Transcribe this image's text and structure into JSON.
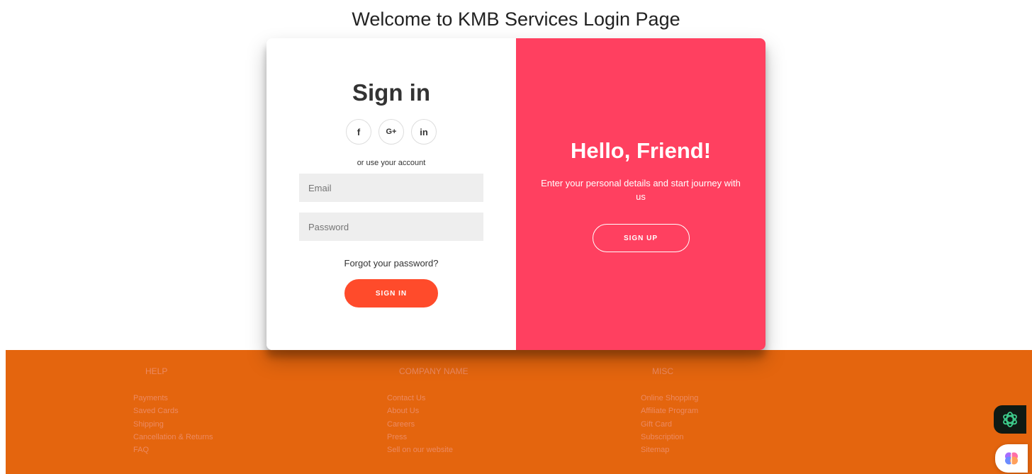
{
  "page": {
    "title": "Welcome to KMB Services Login Page"
  },
  "signin": {
    "title": "Sign in",
    "social": [
      {
        "label": "f",
        "icon": "facebook-icon"
      },
      {
        "label": "G+",
        "icon": "google-plus-icon"
      },
      {
        "label": "in",
        "icon": "linkedin-icon"
      }
    ],
    "use_account": "or use your account",
    "email_placeholder": "Email",
    "email_value": "",
    "password_placeholder": "Password",
    "password_value": "",
    "forgot": "Forgot your password?",
    "button": "SIGN IN"
  },
  "hello": {
    "title": "Hello, Friend!",
    "text": "Enter your personal details and start journey with us",
    "button": "SIGN UP"
  },
  "footer": {
    "help": {
      "heading": "HELP",
      "links": [
        "Payments",
        "Saved Cards",
        "Shipping",
        "Cancellation & Returns",
        "FAQ"
      ]
    },
    "company": {
      "heading": "COMPANY NAME",
      "links": [
        "Contact Us",
        "About Us",
        "Careers",
        "Press",
        "Sell on our website"
      ]
    },
    "misc": {
      "heading": "MISC",
      "links": [
        "Online Shopping",
        "Affiliate Program",
        "Gift Card",
        "Subscription",
        "Sitemap"
      ]
    }
  },
  "colors": {
    "accent": "#ff4b2b",
    "overlay": "#ff4060",
    "footer": "#e4650e",
    "footer_text": "#ec8a62"
  },
  "extensions": [
    {
      "icon": "chatgpt-icon"
    },
    {
      "icon": "brain-icon"
    }
  ]
}
